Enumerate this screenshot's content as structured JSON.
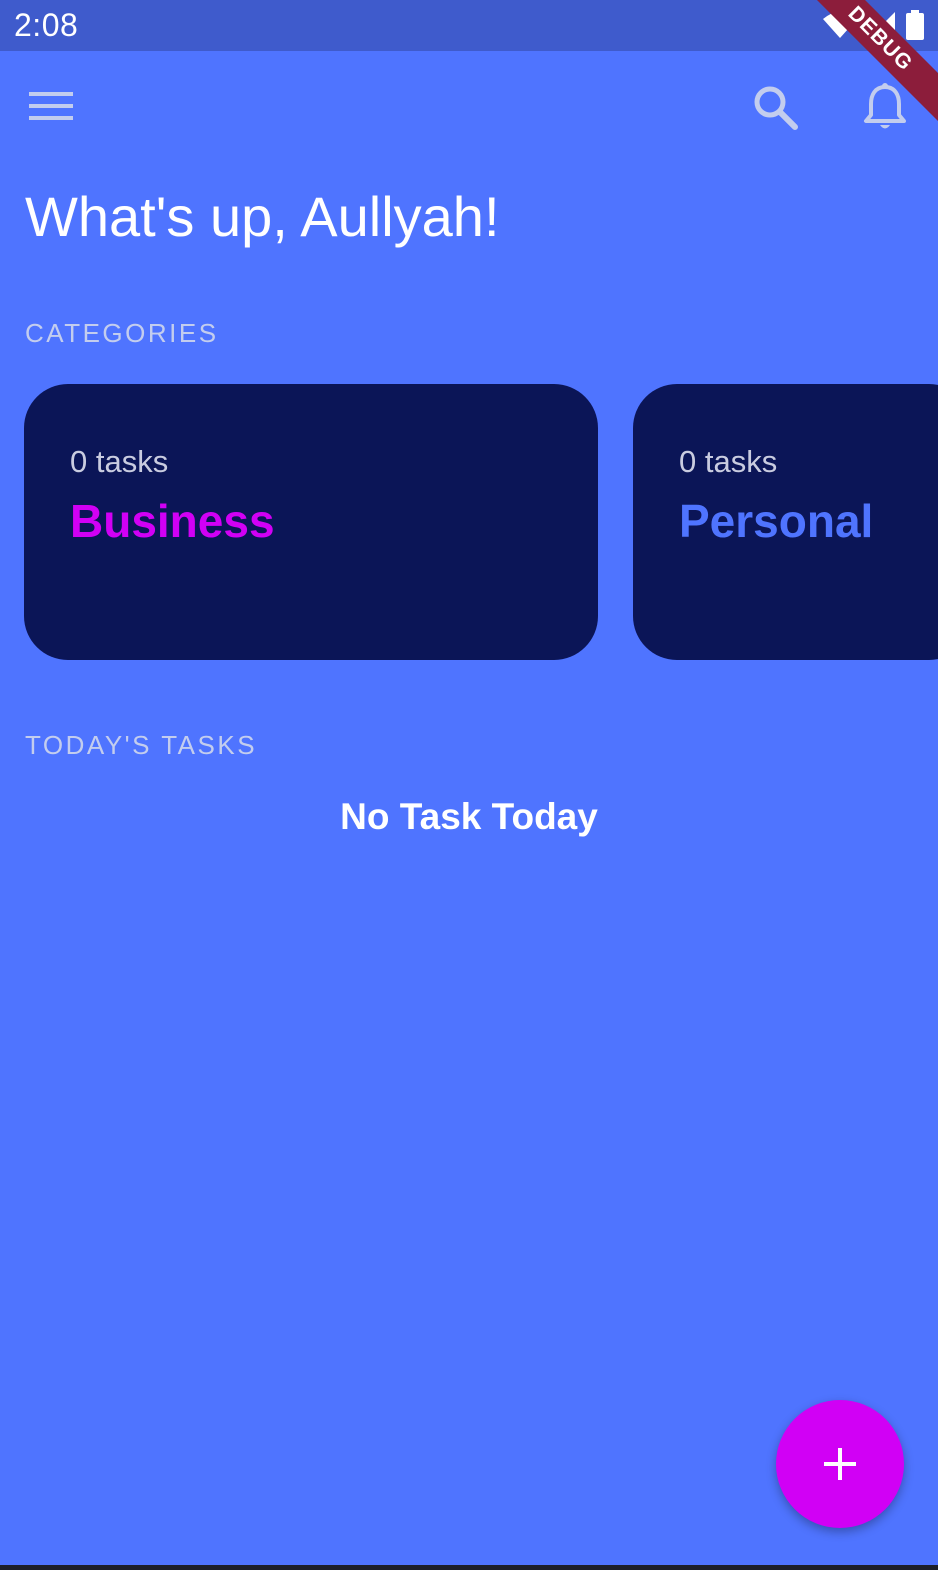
{
  "status_bar": {
    "time": "2:08",
    "icons": [
      "wifi-icon",
      "cell-signal-icon",
      "battery-icon"
    ]
  },
  "debug_banner": {
    "label": "DEBUG",
    "color": "#8c1d3b"
  },
  "app_bar": {
    "icons": [
      "menu-icon",
      "search-icon",
      "bell-icon"
    ]
  },
  "greeting": "What's up, Aullyah!",
  "categories": {
    "label": "CATEGORIES",
    "items": [
      {
        "count": "0 tasks",
        "name": "Business",
        "color": "#d100f5"
      },
      {
        "count": "0 tasks",
        "name": "Personal",
        "color": "#4f74ff"
      }
    ]
  },
  "today": {
    "label": "TODAY'S TASKS",
    "empty_message": "No Task Today"
  },
  "fab": {
    "icon": "plus-icon",
    "color": "#d100f5"
  },
  "colors": {
    "background": "#4f74ff",
    "status_bar": "#3f5bcc",
    "card": "#0b1557",
    "label_text": "#c3cdee"
  }
}
